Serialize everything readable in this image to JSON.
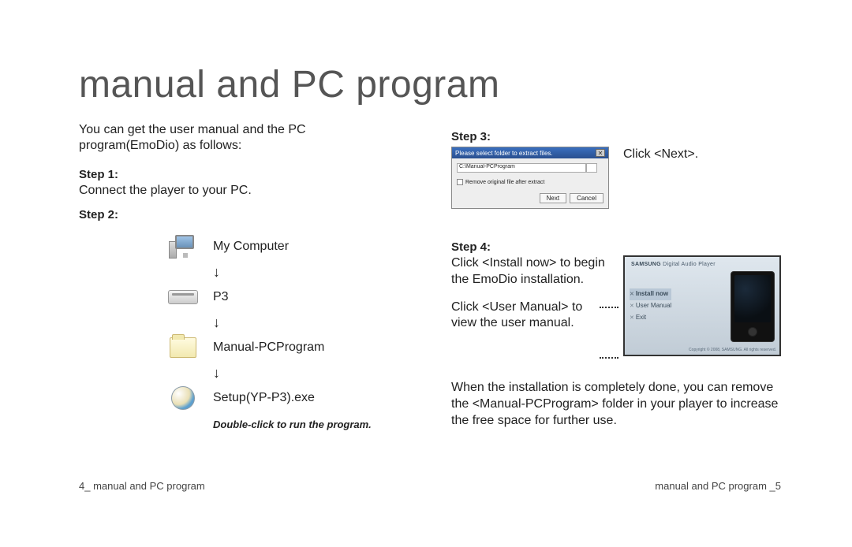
{
  "title": "manual and PC program",
  "intro": "You can get the user manual and the PC program(EmoDio) as follows:",
  "steps": {
    "s1": {
      "label": "Step 1:",
      "text": "Connect the player to your PC."
    },
    "s2": {
      "label": "Step 2:"
    },
    "s3": {
      "label": "Step 3:",
      "text": "Click <Next>."
    },
    "s4": {
      "label": "Step 4:",
      "text1": "Click <Install now> to begin the EmoDio installation.",
      "text2": "Click <User Manual> to view the user manual."
    }
  },
  "nav": {
    "my_computer": "My Computer",
    "p3": "P3",
    "folder": "Manual-PCProgram",
    "exe": "Setup(YP-P3).exe",
    "caption": "Double-click to run the program."
  },
  "dialog": {
    "title": "Please select folder to extract files.",
    "path": "C:\\Manual-PCProgram",
    "chk": "Remove original file after extract",
    "next": "Next",
    "cancel": "Cancel"
  },
  "installer": {
    "brand": "SAMSUNG",
    "subtitle": "Digital Audio Player",
    "menu": {
      "install": "Install now",
      "manual": "User Manual",
      "exit": "Exit"
    },
    "copyright": "Copyright © 2008, SAMSUNG. All rights reserved."
  },
  "finish": "When the installation is completely done, you can remove the <Manual-PCProgram> folder in your player to increase the free space for further use.",
  "footer": {
    "left_num": "4",
    "left_text": "_ manual and PC program",
    "right_text": "manual and PC program _",
    "right_num": "5"
  }
}
